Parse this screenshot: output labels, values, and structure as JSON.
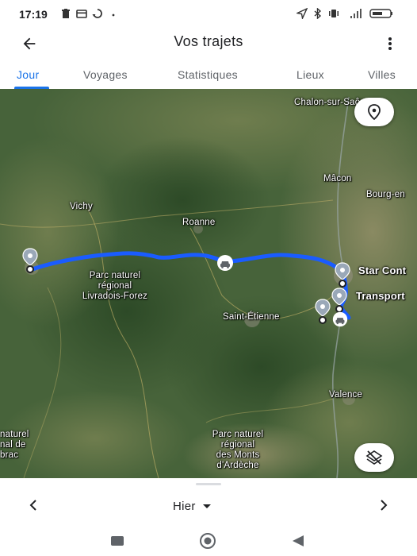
{
  "status_bar": {
    "time": "17:19",
    "left_icons": [
      "trash-icon",
      "card-icon",
      "sync-icon",
      "dot-icon"
    ],
    "right_icons": [
      "location-arrow-icon",
      "bluetooth-icon",
      "vibrate-icon",
      "signal-icon",
      "battery-icon"
    ]
  },
  "app_bar": {
    "title": "Vos trajets",
    "back_icon": "arrow-back-icon",
    "menu_icon": "more-vert-icon"
  },
  "tabs": [
    {
      "label": "Jour",
      "active": true
    },
    {
      "label": "Voyages",
      "active": false
    },
    {
      "label": "Statistiques",
      "active": false
    },
    {
      "label": "Lieux",
      "active": false
    },
    {
      "label": "Villes",
      "active": false
    }
  ],
  "map": {
    "labels": {
      "chalon": "Chalon-sur-Saône",
      "macon": "Mâcon",
      "bourg": "Bourg-en",
      "vichy": "Vichy",
      "roanne": "Roanne",
      "parc_livradois_line1": "Parc naturel",
      "parc_livradois_line2": "régional",
      "parc_livradois_line3": "Livradois-Forez",
      "star_cont": "Star Cont",
      "transport": "Transport",
      "saint_etienne": "Saint-Étienne",
      "valence": "Valence",
      "parc_aubrac_line1": "naturel",
      "parc_aubrac_line2": "nal de",
      "parc_aubrac_line3": "brac",
      "parc_ardeche_line1": "Parc naturel",
      "parc_ardeche_line2": "régional",
      "parc_ardeche_line3": "des Monts",
      "parc_ardeche_line4": "d'Ardèche"
    },
    "route_color": "#1a5cff",
    "fab_top_icon": "place-pin-icon",
    "fab_bottom_icon": "layers-off-icon"
  },
  "sheet": {
    "date_label": "Hier",
    "prev_icon": "chevron-left-icon",
    "next_icon": "chevron-right-icon",
    "dropdown_icon": "arrow-drop-down-icon"
  },
  "nav_bar": {
    "icons": [
      "recents-square-icon",
      "home-circle-icon",
      "back-triangle-icon"
    ]
  },
  "colors": {
    "accent": "#1a73e8",
    "route": "#1a5cff",
    "text_primary": "#202124",
    "text_secondary": "#5f6368"
  }
}
